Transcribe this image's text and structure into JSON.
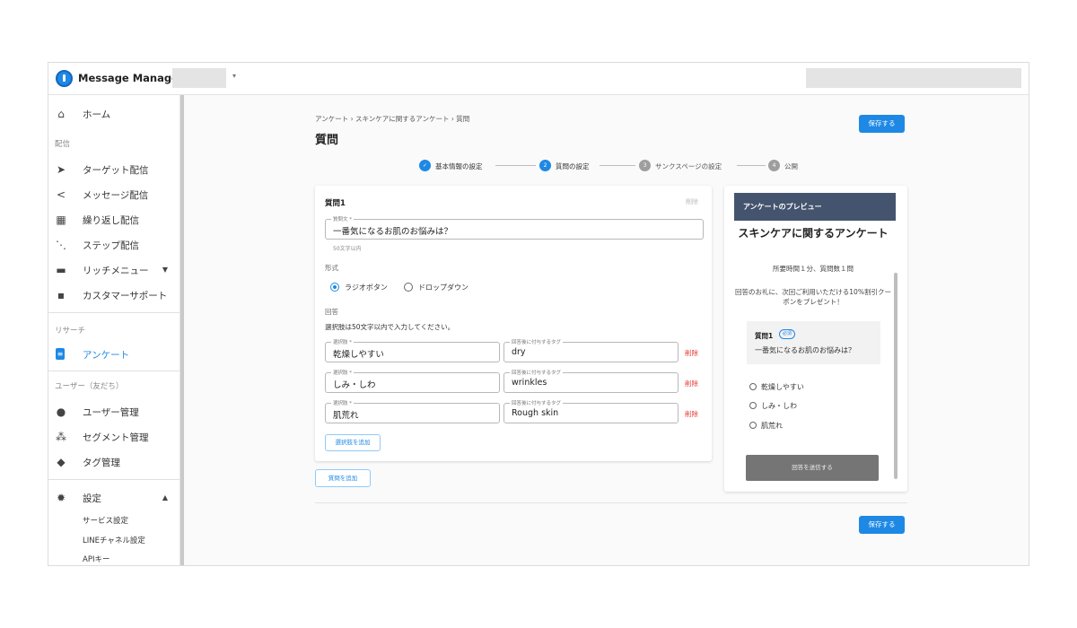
{
  "app": {
    "title": "Message Manager"
  },
  "sidebar": {
    "home": "ホーム",
    "sections": {
      "delivery": "配信",
      "research": "リサーチ",
      "users": "ユーザー（友だち）"
    },
    "items": [
      {
        "label": "ターゲット配信",
        "icon": "send-icon"
      },
      {
        "label": "メッセージ配信",
        "icon": "share-icon"
      },
      {
        "label": "繰り返し配信",
        "icon": "calendar-repeat-icon"
      },
      {
        "label": "ステップ配信",
        "icon": "flow-icon"
      },
      {
        "label": "リッチメニュー",
        "icon": "rich-menu-icon"
      },
      {
        "label": "カスタマーサポート",
        "icon": "chat-icon"
      },
      {
        "label": "アンケート",
        "icon": "survey-icon"
      },
      {
        "label": "ユーザー管理",
        "icon": "user-icon"
      },
      {
        "label": "セグメント管理",
        "icon": "group-icon"
      },
      {
        "label": "タグ管理",
        "icon": "tag-icon"
      },
      {
        "label": "設定",
        "icon": "gear-icon"
      }
    ],
    "settings_sub": [
      "サービス設定",
      "LINEチャネル設定",
      "APIキー"
    ]
  },
  "main": {
    "breadcrumb": "アンケート › スキンケアに関するアンケート › 質問",
    "title": "質問",
    "save_label": "保存する",
    "steps": [
      {
        "num": "1",
        "label": "基本情報の設定",
        "state": "done"
      },
      {
        "num": "2",
        "label": "質問の設定",
        "state": "active"
      },
      {
        "num": "3",
        "label": "サンクスページの設定",
        "state": "pending"
      },
      {
        "num": "4",
        "label": "公開",
        "state": "pending"
      }
    ],
    "question": {
      "title": "質問1",
      "delete_label": "削除",
      "text_label": "質問文 *",
      "text_value": "一番気になるお肌のお悩みは？",
      "text_hint": "50文字以内",
      "format_label": "形式",
      "format_options": [
        "ラジオボタン",
        "ドロップダウン"
      ],
      "answers_label": "回答",
      "answers_instruction": "選択肢は50文字以内で入力してください。",
      "choice_label": "選択肢 *",
      "tag_label": "回答後に付与するタグ",
      "choices": [
        {
          "choice": "乾燥しやすい",
          "tag": "dry"
        },
        {
          "choice": "しみ・しわ",
          "tag": "wrinkles"
        },
        {
          "choice": "肌荒れ",
          "tag": "Rough skin"
        }
      ],
      "add_choice_label": "選択肢を追加"
    },
    "add_question_label": "質問を追加"
  },
  "preview": {
    "header": "アンケートのプレビュー",
    "title": "スキンケアに関するアンケート",
    "meta": "所要時間１分、質問数１問",
    "note": "回答のお礼に、次回ご利用いただける10%割引クーポンをプレゼント！",
    "q_title": "質問1",
    "required": "必須",
    "q_text": "一番気になるお肌のお悩みは？",
    "options": [
      "乾燥しやすい",
      "しみ・しわ",
      "肌荒れ"
    ],
    "submit": "回答を送信する"
  },
  "colors": {
    "accent": "#1e88e5",
    "delete": "#e53935",
    "preview_header": "#45546e"
  }
}
